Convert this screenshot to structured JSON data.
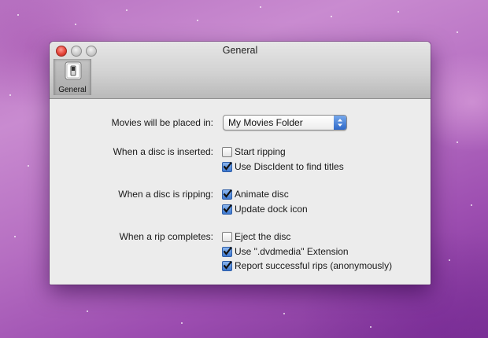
{
  "window": {
    "title": "General",
    "toolbar": {
      "general_label": "General"
    }
  },
  "settings": {
    "movies_location": {
      "label": "Movies will be placed in:",
      "selected": "My Movies Folder"
    },
    "disc_inserted": {
      "label": "When a disc is inserted:",
      "options": [
        {
          "label": "Start ripping",
          "checked": false
        },
        {
          "label": "Use DiscIdent to find titles",
          "checked": true
        }
      ]
    },
    "disc_ripping": {
      "label": "When a disc is ripping:",
      "options": [
        {
          "label": "Animate disc",
          "checked": true
        },
        {
          "label": "Update dock icon",
          "checked": true
        }
      ]
    },
    "rip_completes": {
      "label": "When a rip completes:",
      "options": [
        {
          "label": "Eject the disc",
          "checked": false
        },
        {
          "label": "Use \".dvdmedia\" Extension",
          "checked": true
        },
        {
          "label": "Report successful rips (anonymously)",
          "checked": true
        }
      ]
    }
  },
  "colors": {
    "checkbox_checked": "#3c77cf",
    "close_button": "#e5453a"
  },
  "icons": [
    "general-prefs-switch-icon",
    "checkmark-icon",
    "popup-arrows-icon"
  ]
}
